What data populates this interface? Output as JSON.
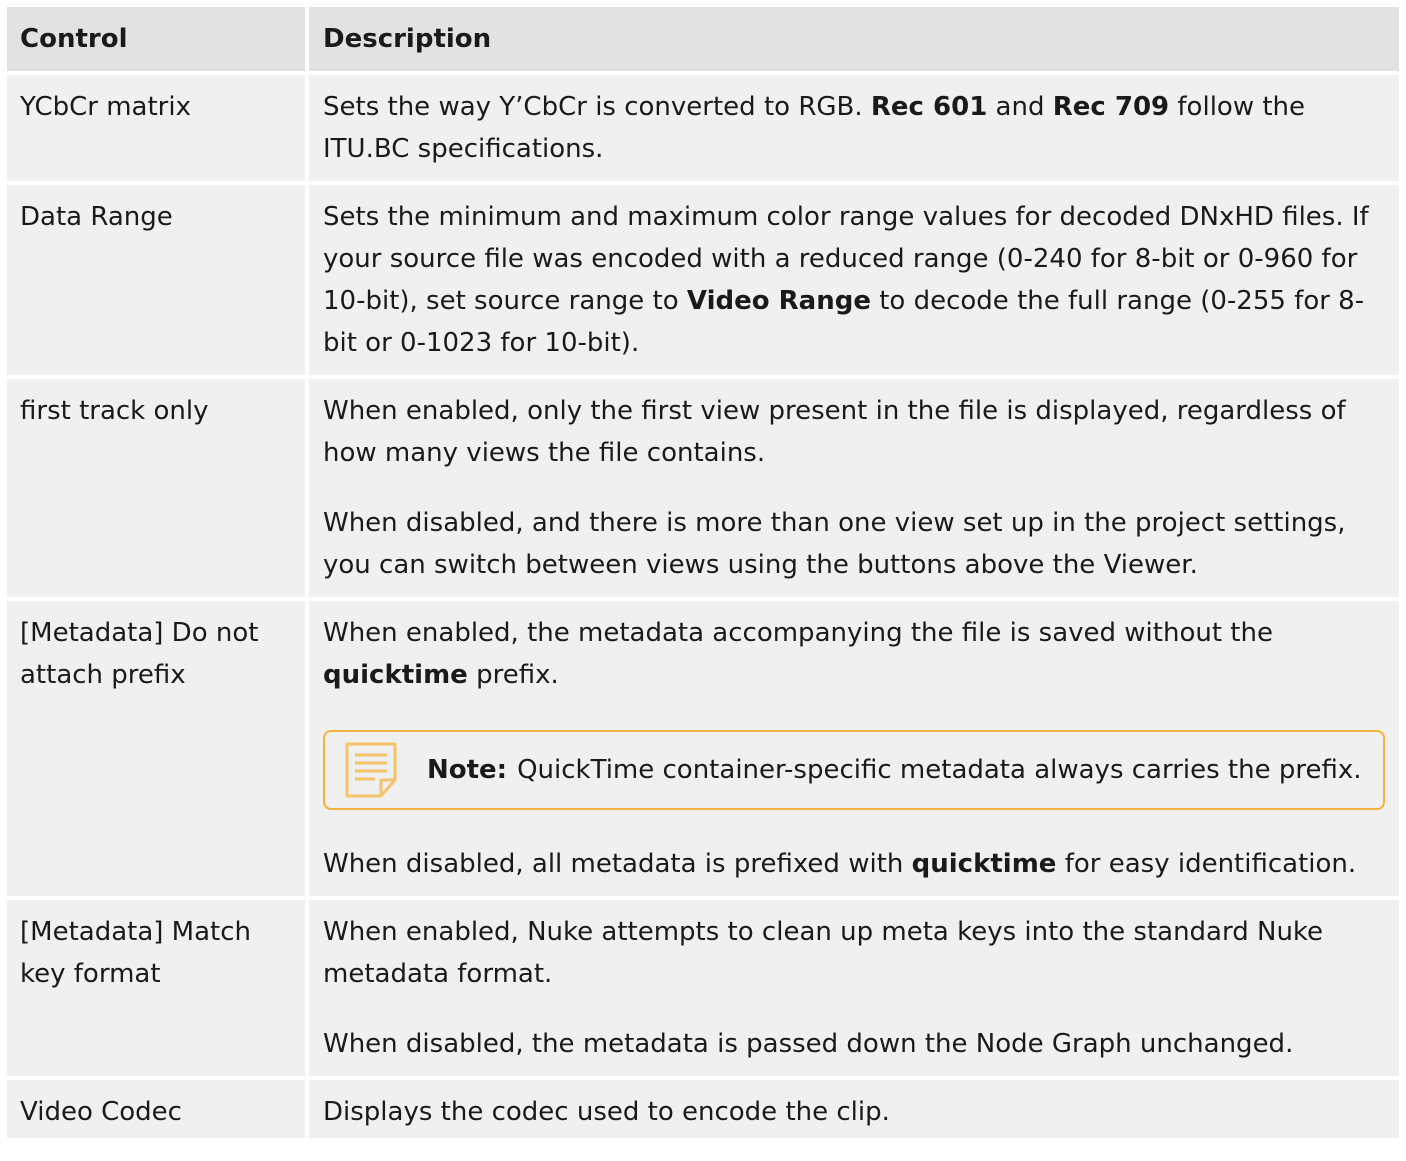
{
  "header": {
    "control": "Control",
    "description": "Description"
  },
  "rows": [
    {
      "control": "YCbCr matrix",
      "desc_pre": "Sets the way Y’CbCr is converted to RGB. ",
      "b1": "Rec 601",
      "mid": " and ",
      "b2": "Rec 709",
      "post": " follow the ITU.BC specifications."
    },
    {
      "control": "Data Range",
      "desc_pre": "Sets the minimum and maximum color range values for decoded DNxHD files. If your source file was encoded with a reduced range (0-240 for 8-bit or 0-960 for 10-bit), set source range to ",
      "b1": "Video Range",
      "post": " to decode the full range (0-255 for 8-bit or 0-1023 for 10-bit)."
    },
    {
      "control": "first track only",
      "p1": "When enabled, only the first view present in the file is displayed, regardless of how many views the file contains.",
      "p2": "When disabled, and there is more than one view set up in the project settings, you can switch between views using the buttons above the Viewer."
    },
    {
      "control": "[Metadata] Do not attach prefix",
      "p1_pre": "When enabled, the metadata accompanying the file is saved without the ",
      "p1_b": "quicktime",
      "p1_post": " prefix.",
      "note_label": "Note:",
      "note_text": "QuickTime container-specific metadata always carries the prefix.",
      "p2_pre": "When disabled, all metadata is prefixed with ",
      "p2_b": "quicktime",
      "p2_post": " for easy identification."
    },
    {
      "control": "[Metadata] Match key format",
      "p1": "When enabled, Nuke attempts to clean up meta keys into the standard Nuke metadata format.",
      "p2": "When disabled, the metadata is passed down the Node Graph unchanged."
    },
    {
      "control": "Video Codec",
      "p1": "Displays the codec used to encode the clip."
    }
  ],
  "colors": {
    "note_border": "#f2b43a",
    "cell_bg": "#f0f0f0",
    "header_bg": "#e2e2e2"
  },
  "icons": {
    "note": "note-document-icon"
  }
}
